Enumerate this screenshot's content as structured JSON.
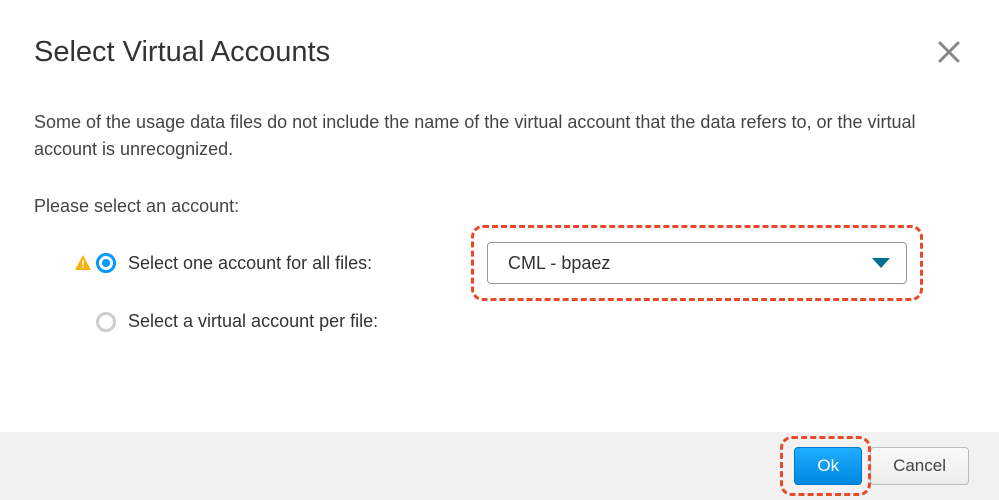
{
  "header": {
    "title": "Select Virtual Accounts"
  },
  "body": {
    "description": "Some of the usage data files do not include the name of the virtual account that the data refers to, or the virtual account is unrecognized.",
    "prompt": "Please select an account:",
    "options": {
      "all_files_label": "Select one account for all files:",
      "per_file_label": "Select a virtual account per file:"
    },
    "dropdown": {
      "selected": "CML - bpaez"
    }
  },
  "footer": {
    "ok_label": "Ok",
    "cancel_label": "Cancel"
  },
  "icons": {
    "close": "close-icon",
    "warning": "warning-icon",
    "caret": "caret-down-icon"
  },
  "colors": {
    "primary": "#0099ff",
    "accent_highlight": "#e84a27",
    "caret": "#036f8f",
    "warning": "#f7b500"
  }
}
